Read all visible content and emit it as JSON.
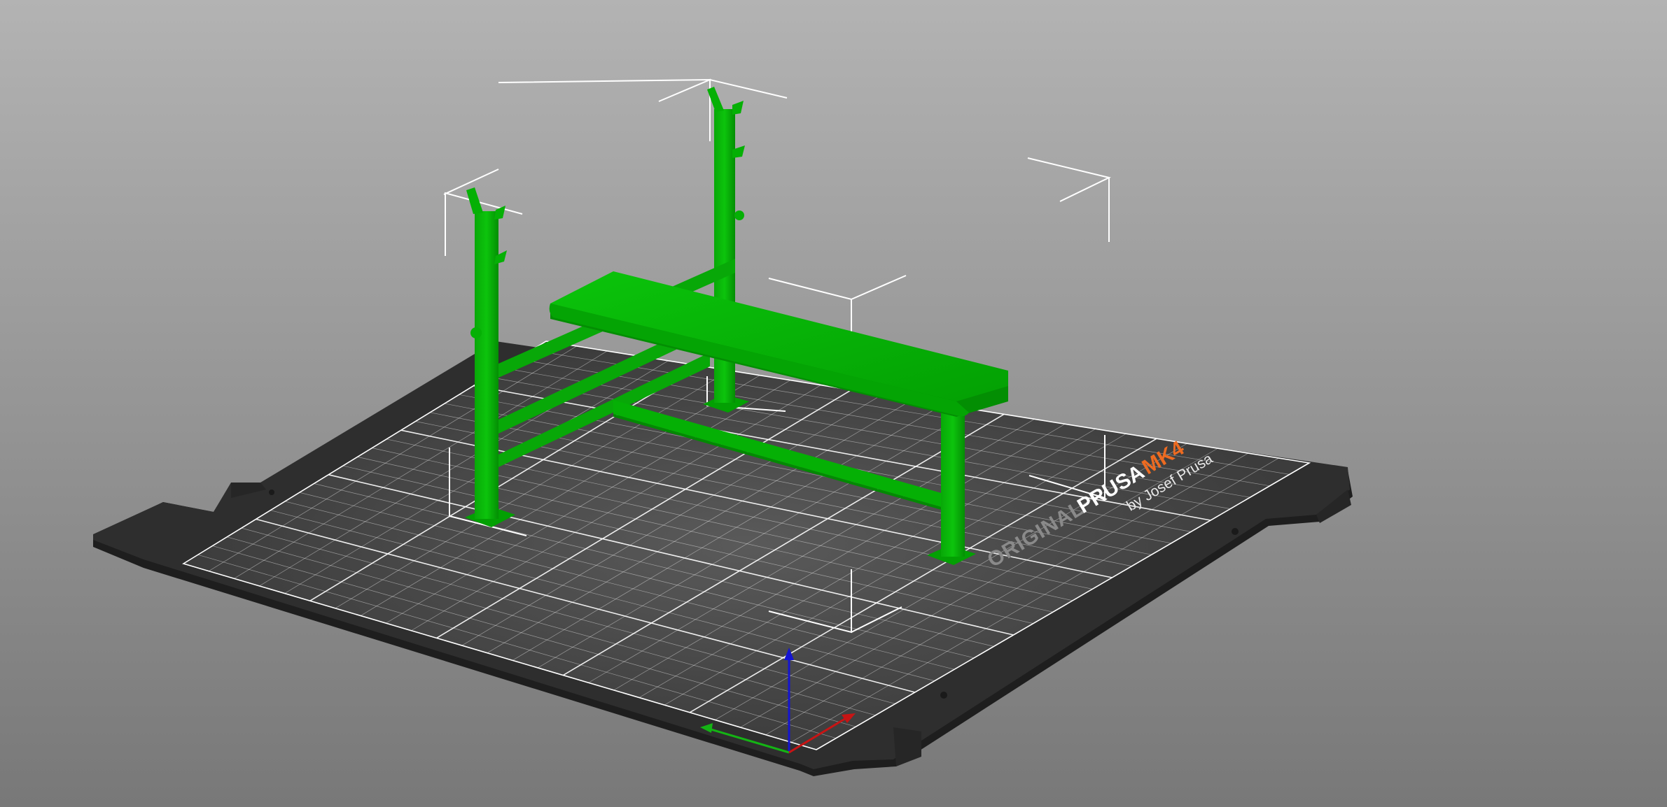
{
  "viewport": {
    "background_top": "#b3b3b3",
    "background_bottom": "#787878",
    "model_color": "#05b005",
    "bed_color": "#2e2e2e",
    "grid_color": "#ffffff",
    "bbox_color": "#ffffff"
  },
  "bed": {
    "logo_original": "ORIGINAL",
    "logo_prusa": "PRUSA",
    "logo_model": "MK4",
    "logo_byline": "by Josef Prusa",
    "logo_accent_color": "#ed6b21"
  },
  "axes": {
    "x_color": "#c81414",
    "y_color": "#14b414",
    "z_color": "#1414d2"
  },
  "objects": [
    {
      "name": "rack-post-left"
    },
    {
      "name": "rack-post-right"
    },
    {
      "name": "bench-seat"
    },
    {
      "name": "bench-leg"
    }
  ]
}
